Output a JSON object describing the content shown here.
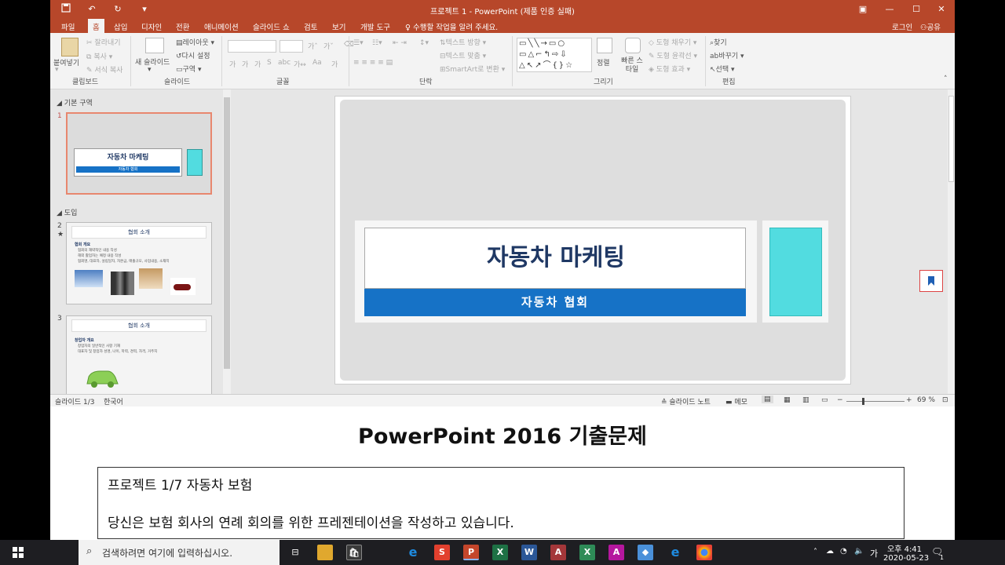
{
  "window": {
    "title": "프로젝트 1 - PowerPoint (제품 인증 실패)"
  },
  "tabs": [
    "파일",
    "홈",
    "삽입",
    "디자인",
    "전환",
    "애니메이션",
    "슬라이드 쇼",
    "검토",
    "보기",
    "개발 도구"
  ],
  "active_tab": "홈",
  "tell_me": "수행할 작업을 알려 주세요.",
  "account": {
    "login": "로그인",
    "share": "공유"
  },
  "ribbon": {
    "clipboard": {
      "paste": "붙여넣기",
      "cut": "잘라내기",
      "copy": "복사",
      "format_painter": "서식 복사",
      "group": "클립보드"
    },
    "slides": {
      "new_slide": "새 슬라이드",
      "layout": "레이아웃",
      "reset": "다시 설정",
      "section": "구역",
      "group": "슬라이드"
    },
    "font": {
      "group": "글꼴",
      "bold": "가",
      "italic": "가",
      "underline": "가",
      "shadow": "S",
      "strike": "abc",
      "spacing": "가↔",
      "case": "Aa",
      "color": "가"
    },
    "paragraph": {
      "group": "단락",
      "text_direction": "텍스트 방향",
      "align_text": "텍스트 맞춤",
      "smartart": "SmartArt로 변환"
    },
    "drawing": {
      "group": "그리기",
      "arrange": "정렬",
      "quick_styles": "빠른 스타일",
      "fill": "도형 채우기",
      "outline": "도형 윤곽선",
      "effects": "도형 효과"
    },
    "editing": {
      "group": "편집",
      "find": "찾기",
      "replace": "바꾸기",
      "select": "선택"
    }
  },
  "slide_pane": {
    "sections": [
      "기본 구역",
      "도입"
    ],
    "thumbnails": [
      {
        "number": "1",
        "title": "자동차 마케팅",
        "subtitle": "자동차 협회"
      },
      {
        "number": "2",
        "title": "협회 소개",
        "bullets": [
          "협회 개요",
          "협회의 재략적인 내용 작성",
          "해외 활업자는 예정 내용 작성",
          "협회명, 대표자, 설립일자, 자본금, 매출규모, 사업내용, 소재지"
        ]
      },
      {
        "number": "3",
        "title": "협회 소개",
        "bullets": [
          "창업자 개요",
          "창업자의 일반적인 사항 기재",
          "대표자 및 창업자 성명, 나이, 학력, 경력, 자격, 거주지"
        ]
      }
    ]
  },
  "slide": {
    "title": "자동차 마케팅",
    "subtitle": "자동차 협회"
  },
  "status": {
    "slide": "슬라이드 1/3",
    "language": "한국어",
    "notes": "슬라이드 노트",
    "comments": "메모",
    "zoom": "69 %"
  },
  "document": {
    "heading": "PowerPoint 2016 기출문제",
    "line1": "프로젝트 1/7 자동차 보험",
    "line2": "당신은 보험 회사의 연례 회의를 위한 프레젠테이션을 작성하고 있습니다."
  },
  "taskbar": {
    "search_placeholder": "검색하려면 여기에 입력하십시오.",
    "time": "오후 4:41",
    "date": "2020-05-23",
    "ime": "가",
    "notification_count": "1"
  },
  "colors": {
    "brand": "#b7472a",
    "subtitle_bar": "#1672c6",
    "accent_shape": "#52dce0"
  }
}
